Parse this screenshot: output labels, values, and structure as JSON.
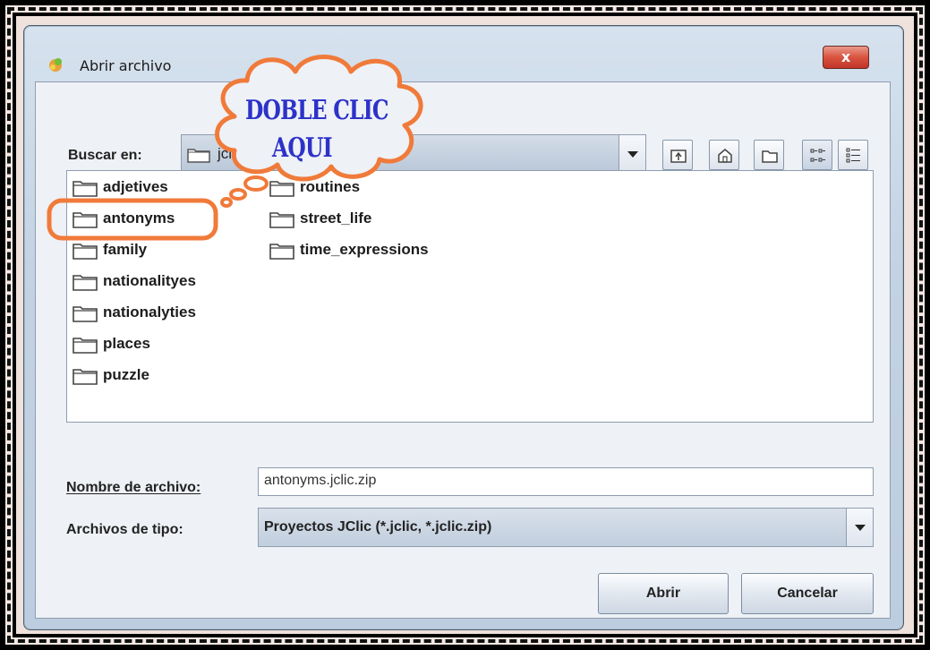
{
  "window": {
    "title": "Abrir archivo",
    "close_label": "x"
  },
  "look_in": {
    "label": "Buscar en:",
    "value": "jclic"
  },
  "toolbar": {
    "icons": [
      "up-folder-icon",
      "home-icon",
      "new-folder-icon",
      "list-view-icon",
      "details-view-icon"
    ]
  },
  "files": [
    "adjetives",
    "antonyms",
    "family",
    "nationalityes",
    "nationalyties",
    "places",
    "puzzle",
    "routines",
    "street_life",
    "time_expressions"
  ],
  "file_name": {
    "label": "Nombre de archivo:",
    "value": "antonyms.jclic.zip"
  },
  "file_type": {
    "label": "Archivos de tipo:",
    "value": "Proyectos JClic (*.jclic, *.jclic.zip)"
  },
  "buttons": {
    "open": "Abrir",
    "cancel": "Cancelar"
  },
  "annotation": {
    "line1": "DOBLE CLIC",
    "line2": "AQUI",
    "color": "#f07a3a",
    "text_color": "#2d32c9"
  }
}
